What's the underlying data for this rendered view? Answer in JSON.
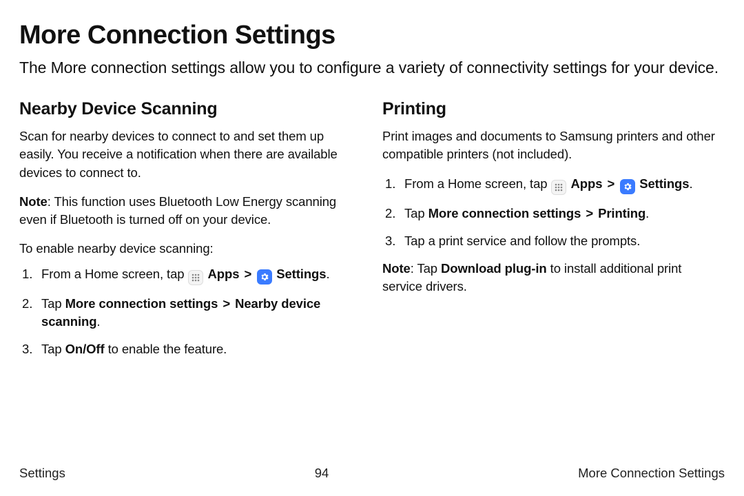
{
  "title": "More Connection Settings",
  "intro": "The More connection settings allow you to configure a variety of connectivity settings for your device.",
  "left": {
    "heading": "Nearby Device Scanning",
    "desc": "Scan for nearby devices to connect to and set them up easily. You receive a notification when there are available devices to connect to.",
    "note_label": "Note",
    "note_body": ": This function uses Bluetooth Low Energy scanning even if Bluetooth is turned off on your device.",
    "lead": "To enable nearby device scanning:",
    "step1_pre": "From a Home screen, tap ",
    "apps": "Apps",
    "settings": "Settings",
    "step2_pre": "Tap ",
    "step2_bold": "More connection settings",
    "step2_bold2": "Nearby device scanning",
    "step3_pre": "Tap ",
    "step3_bold": "On/Off",
    "step3_post": " to enable the feature."
  },
  "right": {
    "heading": "Printing",
    "desc": "Print images and documents to Samsung printers and other compatible printers (not included).",
    "step1_pre": "From a Home screen, tap ",
    "apps": "Apps",
    "settings": "Settings",
    "step2_pre": "Tap ",
    "step2_bold": "More connection settings",
    "step2_bold2": "Printing",
    "step3": "Tap a print service and follow the prompts.",
    "note_label": "Note",
    "note_mid1": ": Tap ",
    "note_bold": "Download plug-in",
    "note_mid2": " to install additional print service drivers."
  },
  "footer": {
    "left": "Settings",
    "center": "94",
    "right": "More Connection Settings"
  },
  "glyphs": {
    "chevron": ">"
  }
}
